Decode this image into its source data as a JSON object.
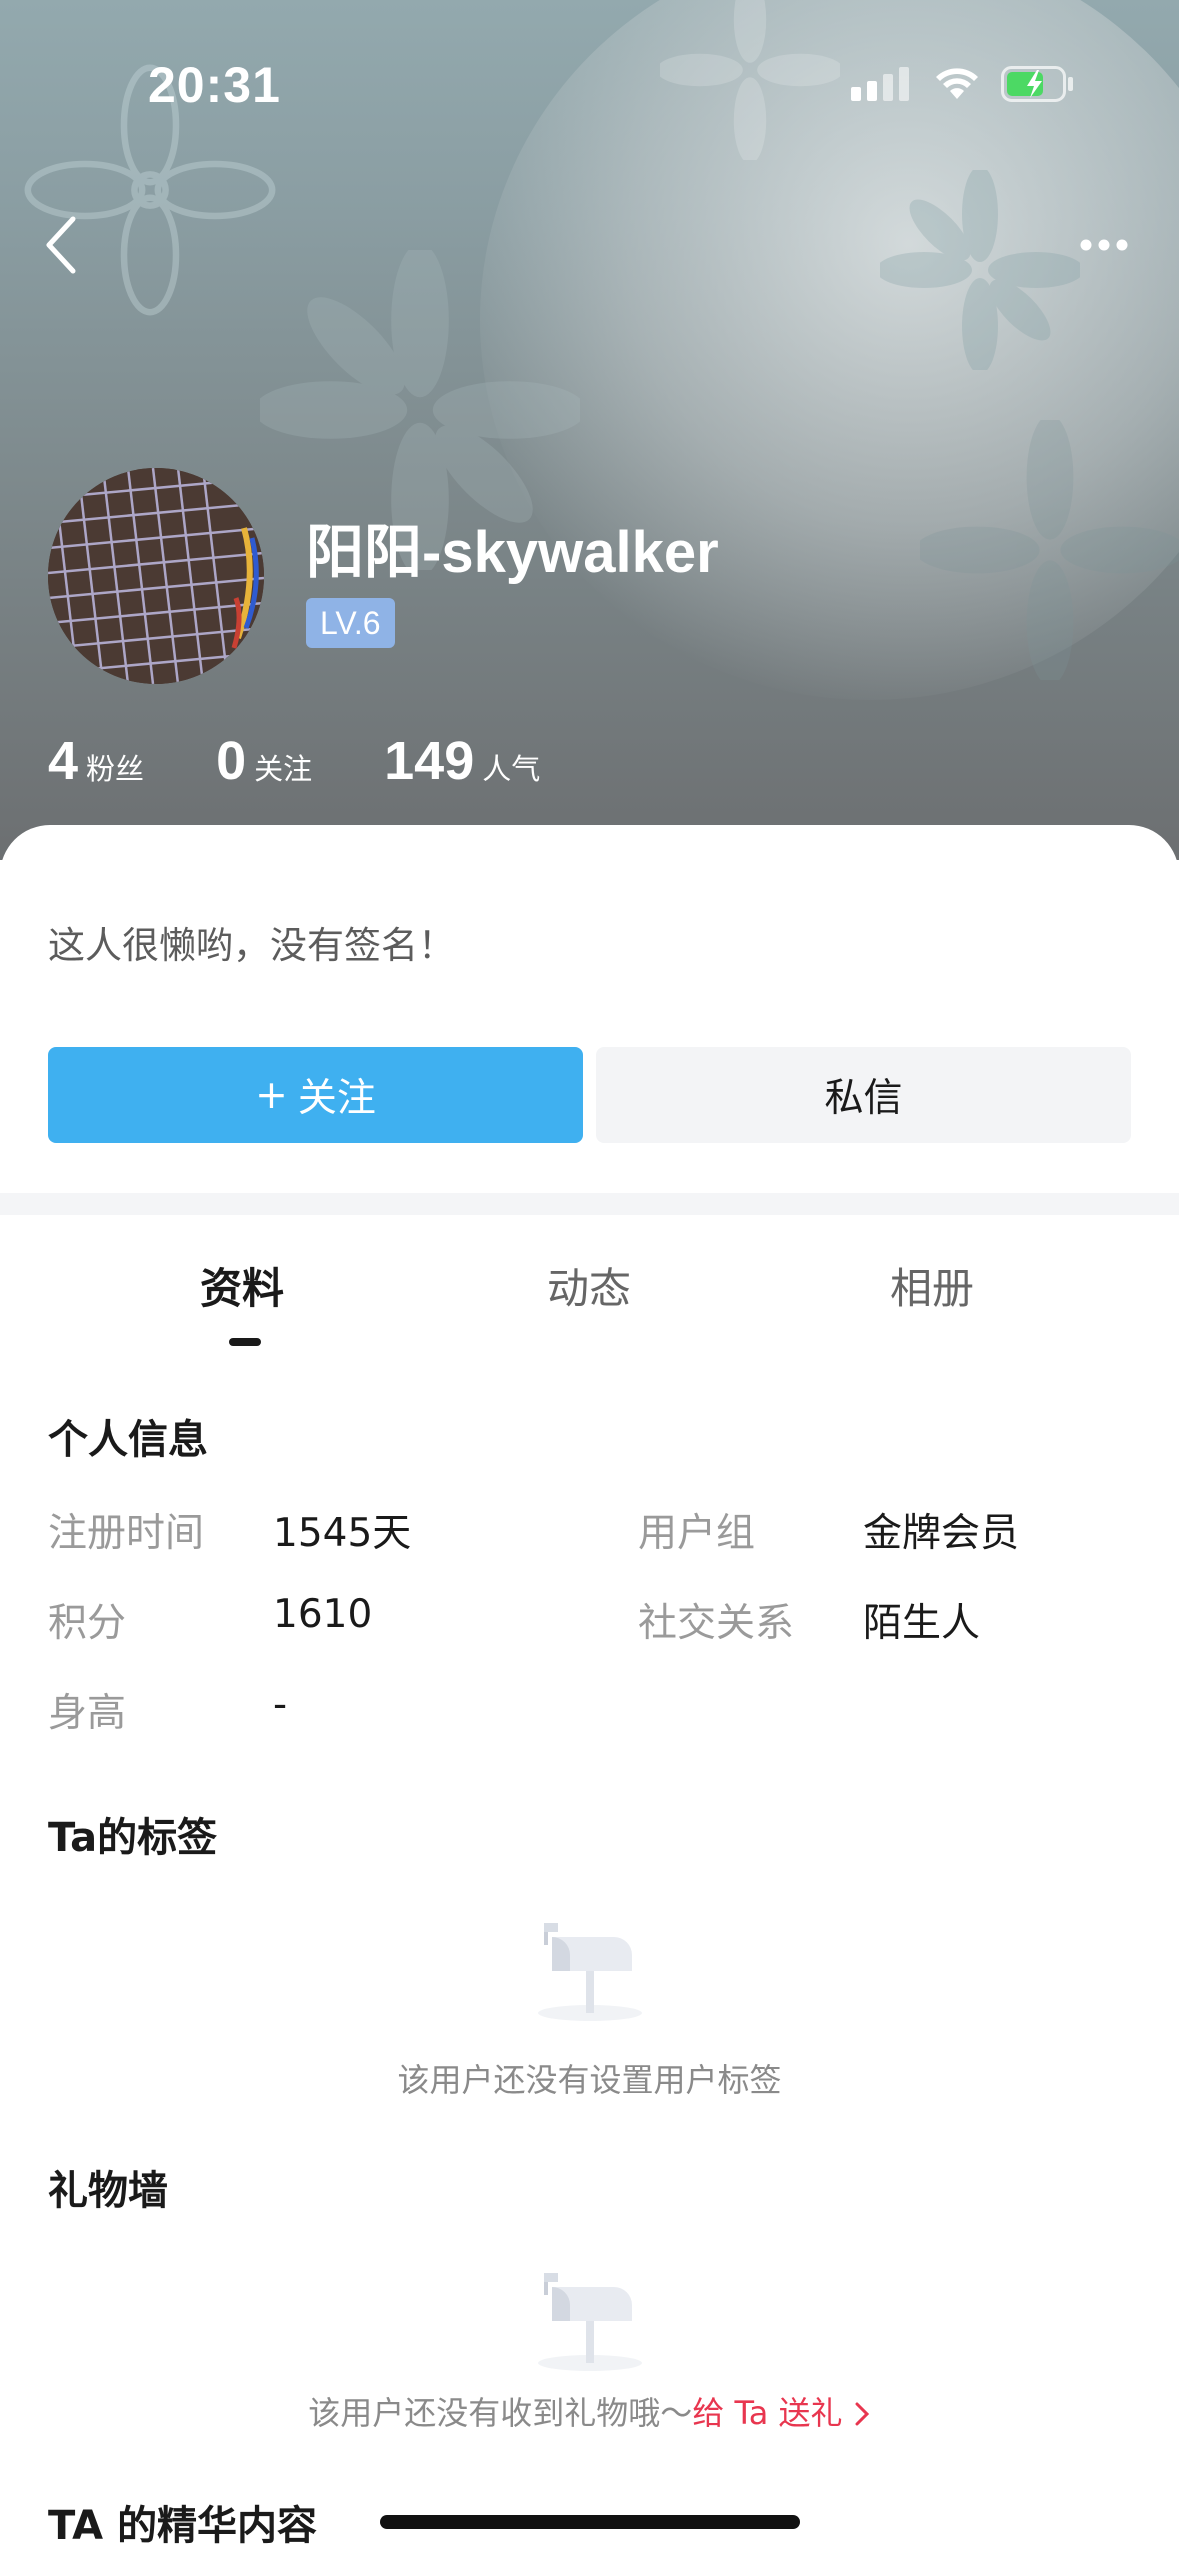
{
  "status_bar": {
    "time": "20:31"
  },
  "profile": {
    "username": "阳阳-skywalker",
    "level": "LV.6",
    "stats": [
      {
        "value": "4",
        "label": "粉丝"
      },
      {
        "value": "0",
        "label": "关注"
      },
      {
        "value": "149",
        "label": "人气"
      }
    ],
    "signature": "这人很懒哟，没有签名！"
  },
  "actions": {
    "follow_label": "关注",
    "follow_prefix": "+",
    "message_label": "私信"
  },
  "tabs": [
    {
      "label": "资料",
      "active": true
    },
    {
      "label": "动态",
      "active": false
    },
    {
      "label": "相册",
      "active": false
    }
  ],
  "personal_info": {
    "title": "个人信息",
    "register_time_label": "注册时间",
    "register_time_value": "1545天",
    "user_group_label": "用户组",
    "user_group_value": "金牌会员",
    "points_label": "积分",
    "points_value": "1610",
    "social_label": "社交关系",
    "social_value": "陌生人",
    "height_label": "身高",
    "height_value": "-"
  },
  "tags_section": {
    "title": "Ta的标签",
    "empty_text": "该用户还没有设置用户标签"
  },
  "gift_section": {
    "title": "礼物墙",
    "empty_text": "该用户还没有收到礼物哦～",
    "link_text": "给 Ta 送礼"
  },
  "featured_section": {
    "title": "TA 的精华内容"
  },
  "colors": {
    "accent": "#3fb0f0",
    "link_red": "#e8364f",
    "level_badge": "#8fb3e6"
  }
}
